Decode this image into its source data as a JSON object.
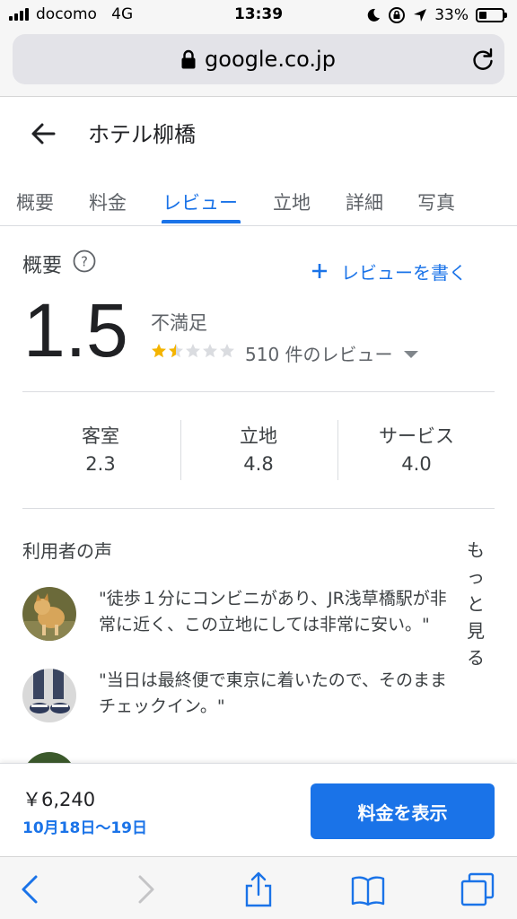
{
  "status_bar": {
    "carrier": "docomo",
    "network": "4G",
    "time": "13:39",
    "battery": "33%",
    "battery_level": 0.33
  },
  "browser": {
    "url": "google.co.jp"
  },
  "header": {
    "title": "ホテル柳橋"
  },
  "tabs": [
    {
      "label": "概要"
    },
    {
      "label": "料金"
    },
    {
      "label": "レビュー",
      "active": true
    },
    {
      "label": "立地"
    },
    {
      "label": "詳細"
    },
    {
      "label": "写真"
    }
  ],
  "overview": {
    "title": "概要",
    "write_review": "レビューを書く",
    "rating": "1.5",
    "rating_desc": "不満足",
    "stars_value": 1.5,
    "stars_max": 5,
    "review_count": "510 件のレビュー"
  },
  "sub_ratings": [
    {
      "label": "客室",
      "value": "2.3"
    },
    {
      "label": "立地",
      "value": "4.8"
    },
    {
      "label": "サービス",
      "value": "4.0"
    }
  ],
  "voices": {
    "title": "利用者の声",
    "more": "もっと見る",
    "items": [
      {
        "text": "\"徒歩１分にコンビニがあり、JR浅草橋駅が非\n常に近く、この立地にしては非常に安い。\""
      },
      {
        "text": "\"当日は最終便で東京に着いたので、そのまま\nチェックイン。\""
      }
    ]
  },
  "booking": {
    "price": "￥6,240",
    "dates": "10月18日～19日",
    "button": "料金を表示"
  },
  "colors": {
    "accent": "#1a73e8",
    "star_filled": "#f4b400",
    "star_empty": "#dadce0"
  }
}
